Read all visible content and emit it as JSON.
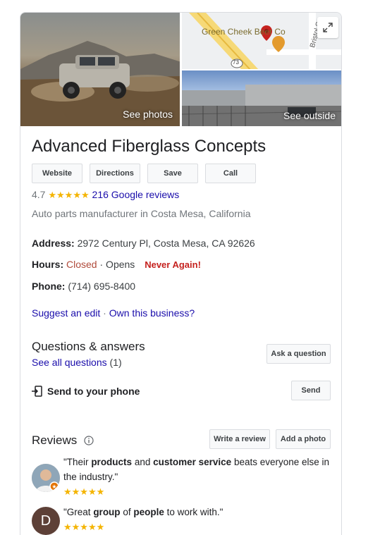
{
  "images": {
    "photos_label": "See photos",
    "outside_label": "See outside",
    "map_business_label": "Green Cheek Beer Co",
    "map_street_label": "Bristol S",
    "map_route_label": "73"
  },
  "business": {
    "name": "Advanced Fiberglass Concepts",
    "rating": "4.7",
    "stars": "★★★★★",
    "reviews_link": "216 Google reviews",
    "category": "Auto parts manufacturer in Costa Mesa, California"
  },
  "actions": {
    "website": "Website",
    "directions": "Directions",
    "save": "Save",
    "call": "Call"
  },
  "details": {
    "address_label": "Address:",
    "address_value": "2972 Century Pl, Costa Mesa, CA 92626",
    "hours_label": "Hours:",
    "hours_status": "Closed",
    "hours_rest": " · Opens",
    "hours_annotation": "Never Again!",
    "phone_label": "Phone:",
    "phone_value": "(714) 695-8400",
    "suggest_edit": "Suggest an edit",
    "separator": " · ",
    "own_business": "Own this business?"
  },
  "qa": {
    "title": "Questions & answers",
    "see_all": "See all questions",
    "count": "(1)",
    "ask_button": "Ask a question"
  },
  "send": {
    "label": "Send to your phone",
    "button": "Send"
  },
  "reviews": {
    "title": "Reviews",
    "write_button": "Write a review",
    "photo_button": "Add a photo",
    "items": [
      {
        "text_parts": [
          "\"Their ",
          "products",
          " and ",
          "customer service",
          " beats everyone else in the industry.\""
        ],
        "stars": "★★★★★"
      },
      {
        "avatar_letter": "D",
        "text_parts": [
          "\"Great ",
          "group",
          " of ",
          "people",
          " to work with.\""
        ],
        "stars": "★★★★★"
      }
    ]
  }
}
